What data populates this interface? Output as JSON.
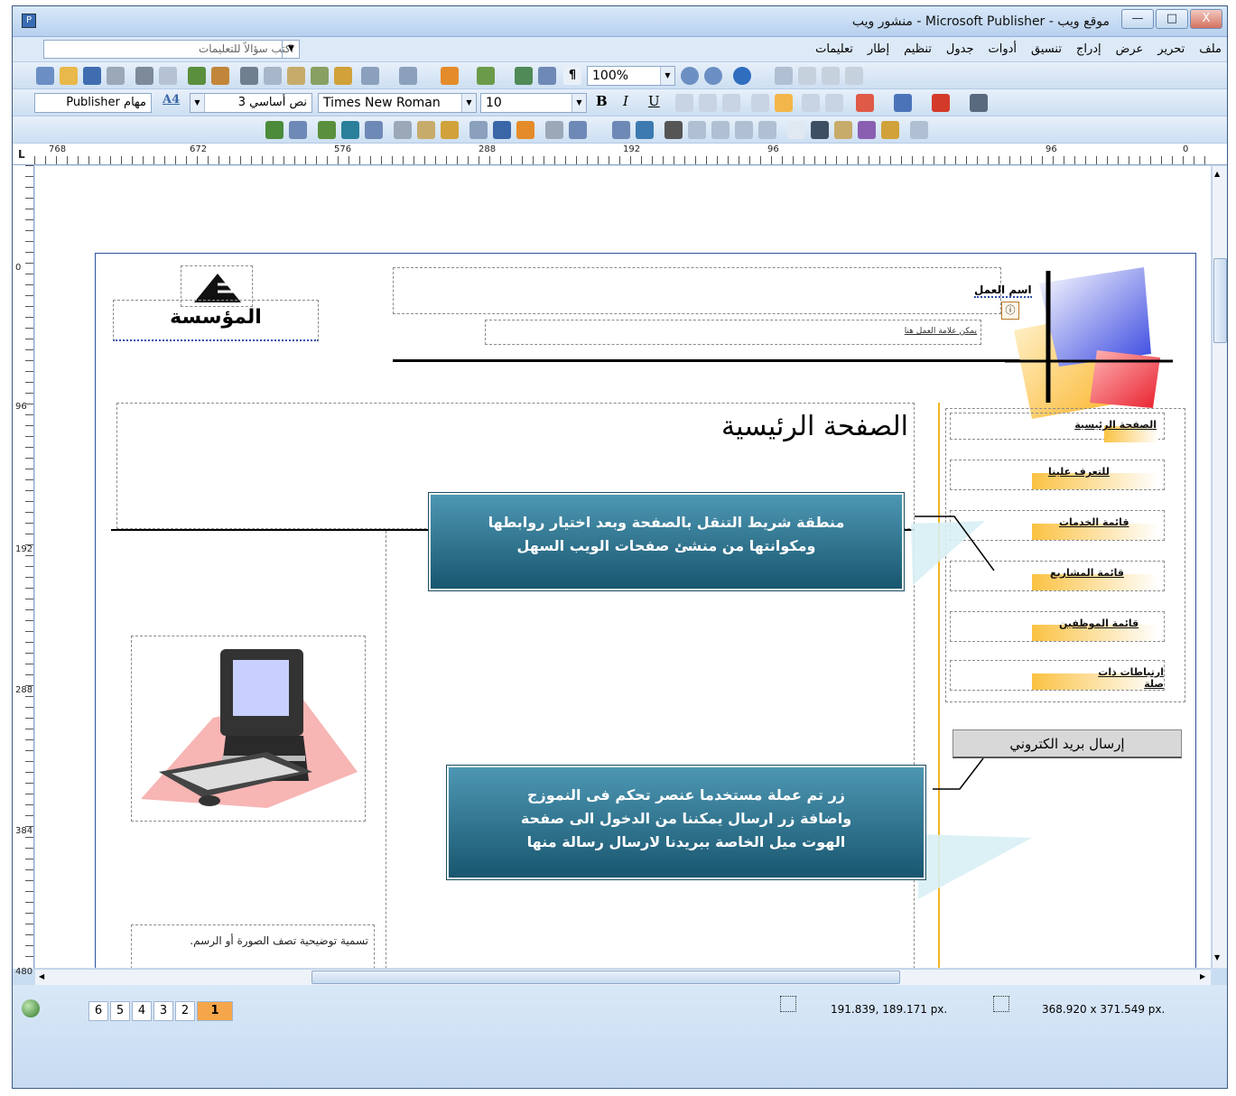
{
  "window": {
    "title": "موقع ويب - Microsoft Publisher - منشور ويب",
    "controls": [
      "—",
      "□",
      "X"
    ]
  },
  "menu": {
    "items": [
      "ملف",
      "تحرير",
      "عرض",
      "إدراج",
      "تنسيق",
      "أدوات",
      "جدول",
      "تنظيم",
      "إطار",
      "تعليمات"
    ],
    "ask_placeholder": "اكتب سؤالاً للتعليمات"
  },
  "toolbar": {
    "zoom": "100%"
  },
  "format_bar": {
    "tasks": "مهام Publisher",
    "style_icon": "A4",
    "style": "نص أساسي 3",
    "font": "Times New Roman",
    "size": "10",
    "bold": "B",
    "italic": "I",
    "underline": "U"
  },
  "ruler": {
    "h_labels": [
      "768",
      "672",
      "576",
      "288",
      "192",
      "96",
      "96",
      "0"
    ],
    "v_labels": [
      "0",
      "96",
      "192",
      "288",
      "384",
      "480"
    ],
    "corner": "L"
  },
  "page": {
    "business_name": "اسم العمل",
    "tagline": "يمكن علامة العمل هنا",
    "org_logo": "المؤسسة",
    "heading": "الصفحة الرئيسية",
    "caption": "تسمية توضيحية تصف الصورة أو الرسم.",
    "email_button": "إرسال بريد الكتروني",
    "nav": [
      "الصفحة الرئيسية",
      "للتعرف علينا",
      "قائمة الخدمات",
      "قائمة المشاريع",
      "قائمة الموظفين",
      "ارتباطات ذات صلة"
    ],
    "callout1": [
      "منطقة شريط التنقل بالصفحة وبعد اختيار روابطها",
      "ومكوانتها من منشئ صفحات الويب السهل"
    ],
    "callout2": [
      "زر تم عملة مستخدما عنصر تحكم فى النموزج",
      "واضافة زر ارسال يمكننا من الدخول الى صفحة",
      "الهوت ميل الخاصة ببريدنا لارسال رسالة منها"
    ]
  },
  "status": {
    "pages": [
      "6",
      "5",
      "4",
      "3",
      "2",
      "1"
    ],
    "active_page": "1",
    "position": "191.839, 189.171 px.",
    "size": "368.920 x 371.549 px."
  },
  "colors": {
    "accent": "#fbc243",
    "callout": "#1f6d8a"
  }
}
